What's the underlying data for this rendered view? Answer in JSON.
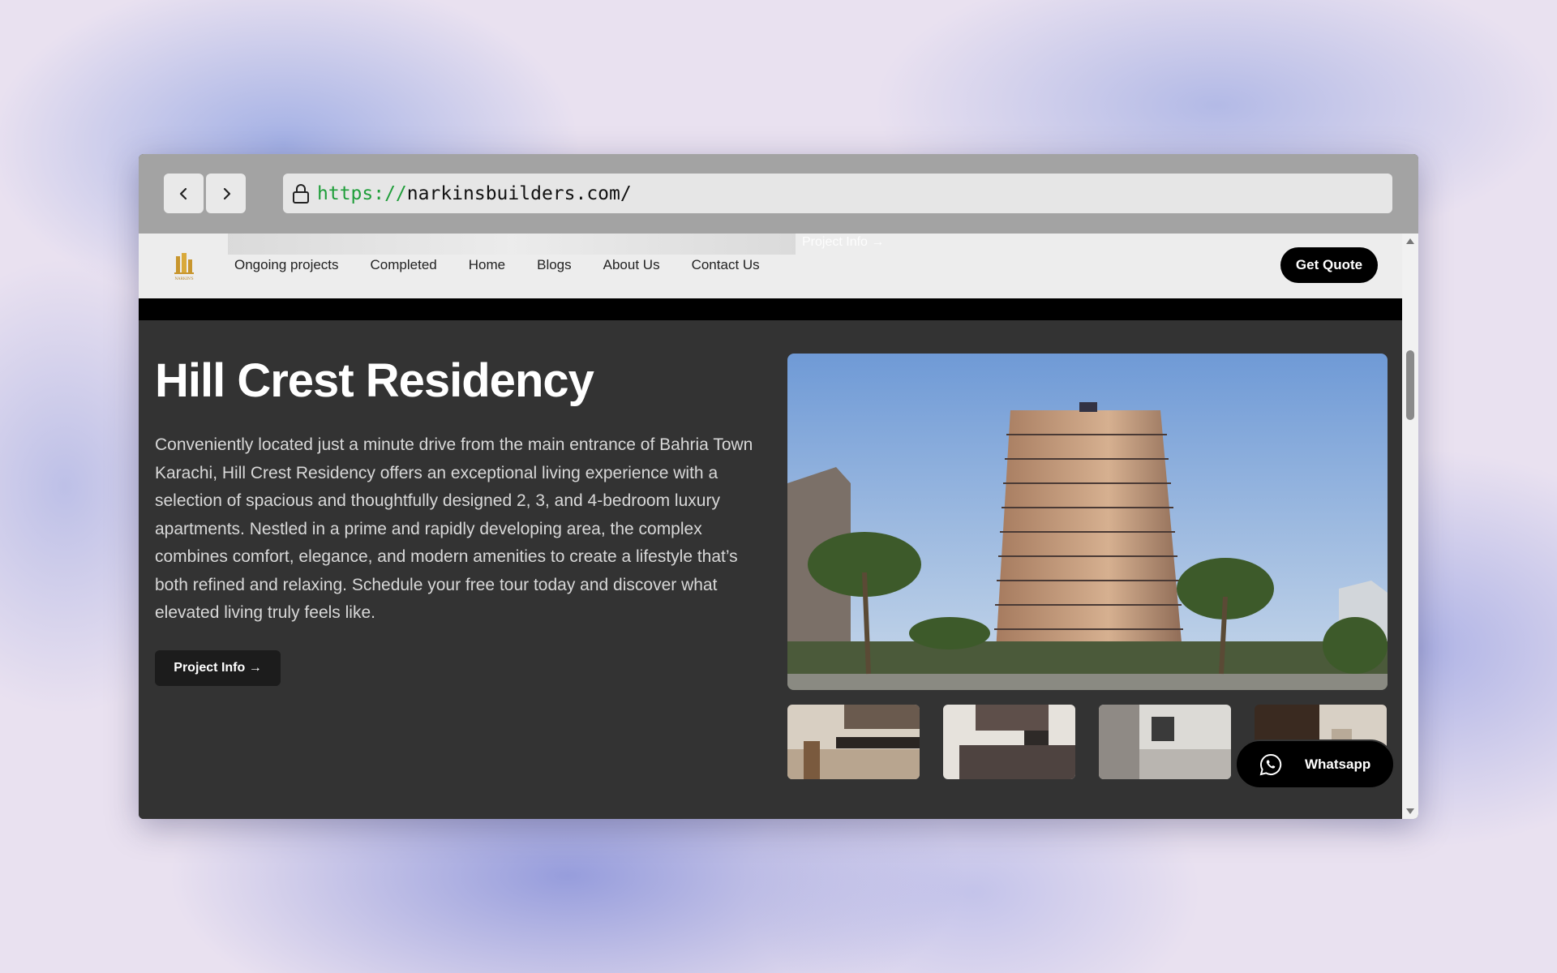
{
  "browser": {
    "url_scheme": "https://",
    "url_host": "narkinsbuilders.com/"
  },
  "header": {
    "logo_text": "NARKIN'S",
    "ghost_link": "Project Info →",
    "nav": [
      "Ongoing projects",
      "Completed",
      "Home",
      "Blogs",
      "About Us",
      "Contact Us"
    ],
    "cta": "Get Quote"
  },
  "hero": {
    "title": "Hill Crest Residency",
    "description": "Conveniently located just a minute drive from the main entrance of Bahria Town Karachi, Hill Crest Residency offers an exceptional living experience with a selection of spacious and thoughtfully designed 2, 3, and 4-bedroom luxury apartments. Nestled in a prime and rapidly developing area, the complex combines comfort, elegance, and modern amenities to create a lifestyle that’s both refined and relaxing. Schedule your free tour today and discover what elevated living truly feels like.",
    "button": "Project Info →"
  },
  "gallery": {
    "main_image": "building-photo",
    "thumbnails": [
      "kitchen-photo-1",
      "kitchen-photo-2",
      "kitchen-photo-3",
      "room-photo-4"
    ]
  },
  "whatsapp": {
    "label": "Whatsapp",
    "icon": "whatsapp-icon"
  },
  "colors": {
    "url_scheme": "#1f9e3a",
    "hero_bg": "#333333",
    "header_bg": "#ededed"
  }
}
